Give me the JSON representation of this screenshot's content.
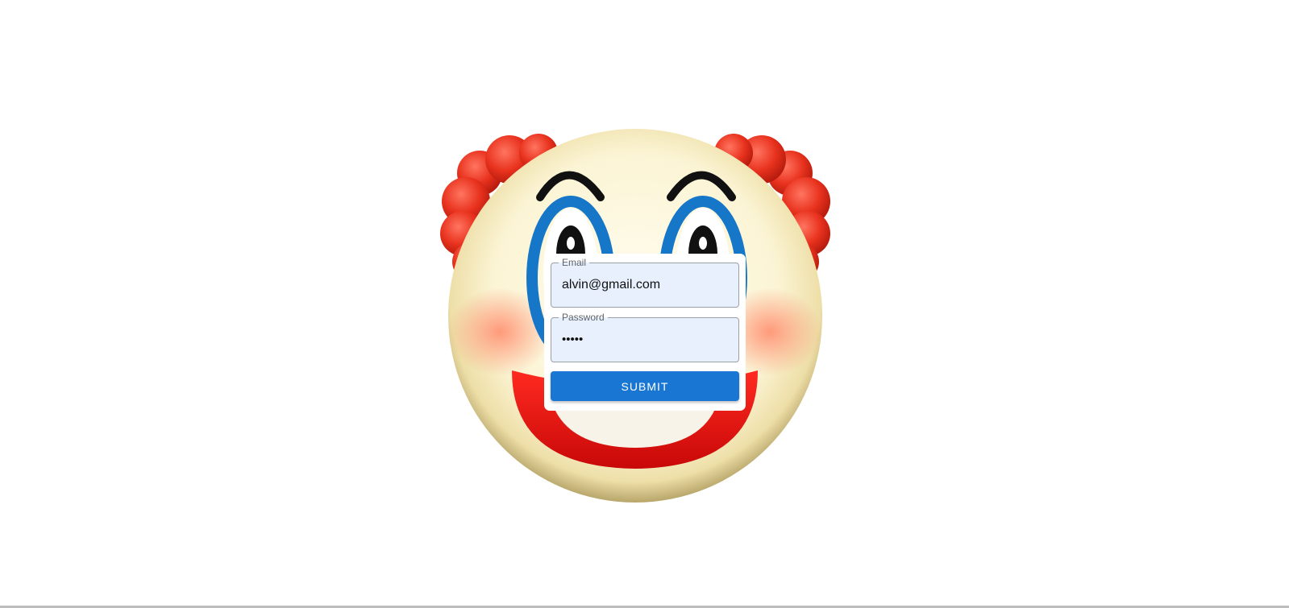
{
  "login": {
    "email_label": "Email",
    "email_value": "alvin@gmail.com",
    "password_label": "Password",
    "password_value": "•••••",
    "submit_label": "SUBMIT"
  },
  "icons": {
    "background": "clown-face-icon"
  },
  "colors": {
    "page_background": "#ffffff",
    "field_background": "#e8f0fe",
    "submit_button": "#1976d2",
    "clown_hair": "#e8321e",
    "clown_eye_ring": "#1677c9",
    "clown_mouth": "#f01414",
    "clown_face": "#fbf4d4"
  }
}
